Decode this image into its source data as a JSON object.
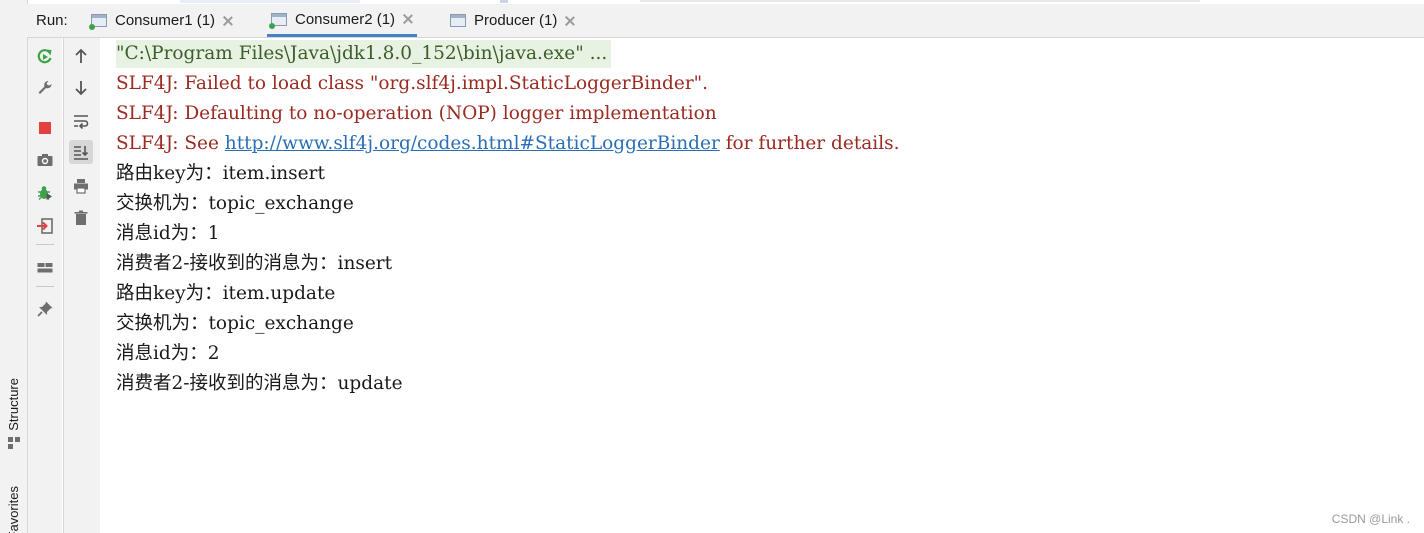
{
  "run_panel": {
    "run_label": "Run:",
    "tabs": [
      {
        "label": "Consumer1 (1)",
        "active": false,
        "running": true
      },
      {
        "label": "Consumer2 (1)",
        "active": true,
        "running": true
      },
      {
        "label": "Producer (1)",
        "active": false,
        "running": false
      }
    ]
  },
  "side_tabs": {
    "structure": "Structure",
    "favorites": "Favorites"
  },
  "toolbar_left": [
    {
      "icon": "rerun-icon",
      "tooltip": "Rerun"
    },
    {
      "icon": "wrench-icon",
      "tooltip": "Modify Run Configuration"
    },
    {
      "icon": "stop-icon",
      "tooltip": "Stop"
    },
    {
      "icon": "camera-icon",
      "tooltip": "Dump Threads"
    },
    {
      "icon": "debug-icon",
      "tooltip": "Debug"
    },
    {
      "icon": "exit-icon",
      "tooltip": "Exit"
    },
    {
      "icon": "layout-icon",
      "tooltip": "Layout"
    },
    {
      "icon": "pin-icon",
      "tooltip": "Pin Tab"
    }
  ],
  "toolbar_right": [
    {
      "icon": "arrow-up-icon"
    },
    {
      "icon": "arrow-down-icon"
    },
    {
      "icon": "soft-wrap-icon"
    },
    {
      "icon": "scroll-to-end-icon"
    },
    {
      "icon": "print-icon"
    },
    {
      "icon": "trash-icon"
    }
  ],
  "console": {
    "command": "\"C:\\Program Files\\Java\\jdk1.8.0_152\\bin\\java.exe\" ...",
    "slf4j_1": "SLF4J: Failed to load class \"org.slf4j.impl.StaticLoggerBinder\".",
    "slf4j_2": "SLF4J: Defaulting to no-operation (NOP) logger implementation",
    "slf4j_3_prefix": "SLF4J: See ",
    "slf4j_3_link": "http://www.slf4j.org/codes.html#StaticLoggerBinder",
    "slf4j_3_suffix": " for further details.",
    "lines": [
      "路由key为：item.insert",
      "交换机为：topic_exchange",
      "消息id为：1",
      "消费者2-接收到的消息为：insert",
      "路由key为：item.update",
      "交换机为：topic_exchange",
      "消息id为：2",
      "消费者2-接收到的消息为：update"
    ]
  },
  "watermark": "CSDN @Link .",
  "colors": {
    "accent": "#4083c9",
    "error_text": "#9b2a21",
    "link": "#2a6fb5",
    "command_bg": "#e7f2e3",
    "command_text": "#3c5c29",
    "stop_red": "#e04141",
    "run_green": "#3ea24a"
  }
}
